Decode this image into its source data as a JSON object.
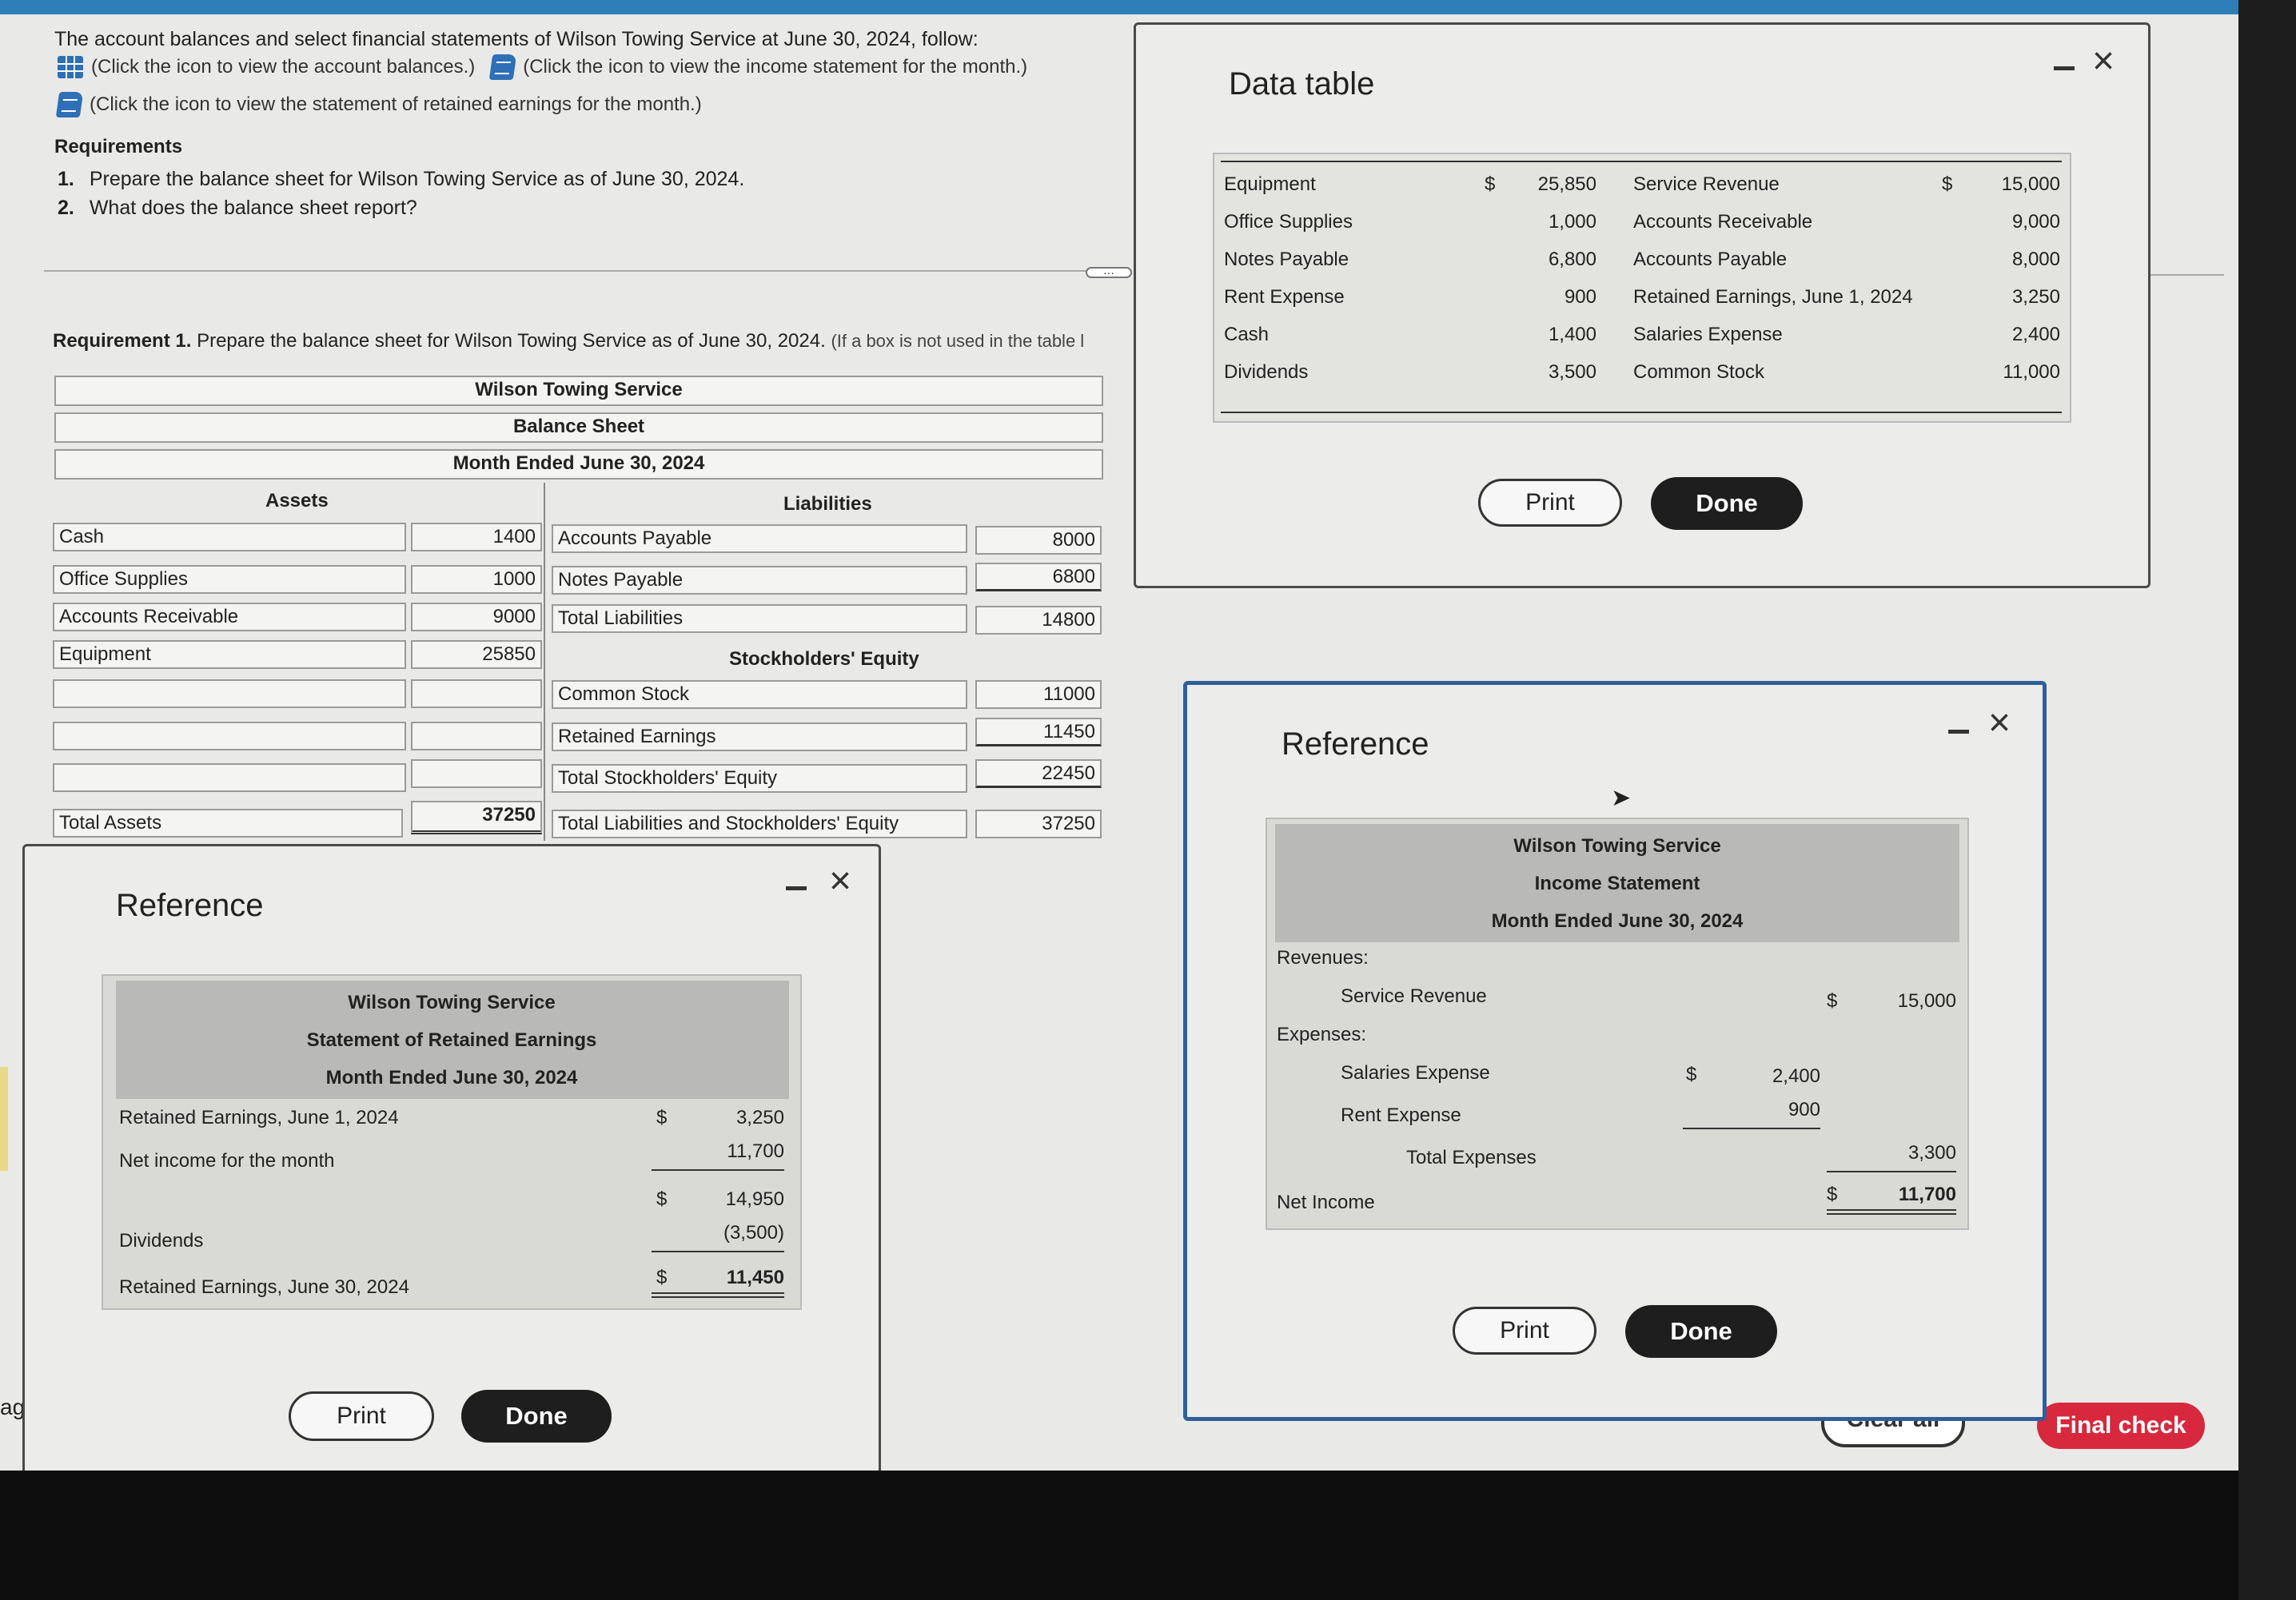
{
  "instructions": {
    "intro": "The account balances and select financial statements of Wilson Towing Service at June 30, 2024, follow:",
    "link_balances": "(Click the icon to view the account balances.)",
    "link_income": "(Click the icon to view the income statement for the month.)",
    "link_retained": "(Click the icon to view the statement of retained earnings for the month.)",
    "requirements_heading": "Requirements",
    "requirements": [
      {
        "num": "1.",
        "text": "Prepare the balance sheet for Wilson Towing Service as of June 30, 2024."
      },
      {
        "num": "2.",
        "text": "What does the balance sheet report?"
      }
    ],
    "req1_bold": "Requirement 1.",
    "req1_text": "Prepare the balance sheet for Wilson Towing Service as of June 30, 2024.",
    "req1_note": "(If a box is not used in the table l"
  },
  "balance_sheet": {
    "company": "Wilson Towing Service",
    "title": "Balance Sheet",
    "period": "Month Ended June 30, 2024",
    "assets_heading": "Assets",
    "liabilities_heading": "Liabilities",
    "equity_heading": "Stockholders' Equity",
    "assets": [
      {
        "label": "Cash",
        "value": "1400"
      },
      {
        "label": "Office Supplies",
        "value": "1000"
      },
      {
        "label": "Accounts Receivable",
        "value": "9000"
      },
      {
        "label": "Equipment",
        "value": "25850"
      },
      {
        "label": "",
        "value": ""
      },
      {
        "label": "",
        "value": ""
      },
      {
        "label": "",
        "value": ""
      }
    ],
    "total_assets_label": "Total Assets",
    "total_assets_value": "37250",
    "liabilities": [
      {
        "label": "Accounts Payable",
        "value": "8000"
      },
      {
        "label": "Notes Payable",
        "value": "6800"
      },
      {
        "label": "Total Liabilities",
        "value": "14800"
      }
    ],
    "equity": [
      {
        "label": "Common Stock",
        "value": "11000"
      },
      {
        "label": "Retained Earnings",
        "value": "11450"
      },
      {
        "label": "Total Stockholders' Equity",
        "value": "22450"
      }
    ],
    "total_le_label": "Total Liabilities and Stockholders' Equity",
    "total_le_value": "37250"
  },
  "data_table_dialog": {
    "title": "Data table",
    "left": [
      {
        "label": "Equipment",
        "dollar": "$",
        "value": "25,850"
      },
      {
        "label": "Office Supplies",
        "dollar": "",
        "value": "1,000"
      },
      {
        "label": "Notes Payable",
        "dollar": "",
        "value": "6,800"
      },
      {
        "label": "Rent Expense",
        "dollar": "",
        "value": "900"
      },
      {
        "label": "Cash",
        "dollar": "",
        "value": "1,400"
      },
      {
        "label": "Dividends",
        "dollar": "",
        "value": "3,500"
      }
    ],
    "right": [
      {
        "label": "Service Revenue",
        "dollar": "$",
        "value": "15,000"
      },
      {
        "label": "Accounts Receivable",
        "dollar": "",
        "value": "9,000"
      },
      {
        "label": "Accounts Payable",
        "dollar": "",
        "value": "8,000"
      },
      {
        "label": "Retained Earnings, June 1, 2024",
        "dollar": "",
        "value": "3,250"
      },
      {
        "label": "Salaries Expense",
        "dollar": "",
        "value": "2,400"
      },
      {
        "label": "Common Stock",
        "dollar": "",
        "value": "11,000"
      }
    ],
    "print_label": "Print",
    "done_label": "Done"
  },
  "retained_dialog": {
    "title": "Reference",
    "company": "Wilson Towing Service",
    "statement": "Statement of Retained Earnings",
    "period": "Month Ended June 30, 2024",
    "rows": {
      "re_begin_label": "Retained Earnings, June 1, 2024",
      "re_begin_dollar": "$",
      "re_begin_value": "3,250",
      "net_income_label": "Net income for the month",
      "net_income_value": "11,700",
      "subtotal_dollar": "$",
      "subtotal_value": "14,950",
      "dividends_label": "Dividends",
      "dividends_value": "(3,500)",
      "re_end_label": "Retained Earnings, June 30, 2024",
      "re_end_dollar": "$",
      "re_end_value": "11,450"
    },
    "print_label": "Print",
    "done_label": "Done"
  },
  "income_dialog": {
    "title": "Reference",
    "company": "Wilson Towing Service",
    "statement": "Income Statement",
    "period": "Month Ended June 30, 2024",
    "revenues_label": "Revenues:",
    "service_revenue_label": "Service Revenue",
    "service_revenue_dollar": "$",
    "service_revenue_value": "15,000",
    "expenses_label": "Expenses:",
    "salaries_label": "Salaries Expense",
    "salaries_dollar": "$",
    "salaries_value": "2,400",
    "rent_label": "Rent Expense",
    "rent_value": "900",
    "total_expenses_label": "Total Expenses",
    "total_expenses_value": "3,300",
    "net_income_label": "Net Income",
    "net_income_dollar": "$",
    "net_income_value": "11,700",
    "print_label": "Print",
    "done_label": "Done"
  },
  "footer": {
    "clear_all_label": "Clear all",
    "final_check_label": "Final check",
    "side_fragment": "ag",
    "final_check_color": "#d8283d"
  }
}
